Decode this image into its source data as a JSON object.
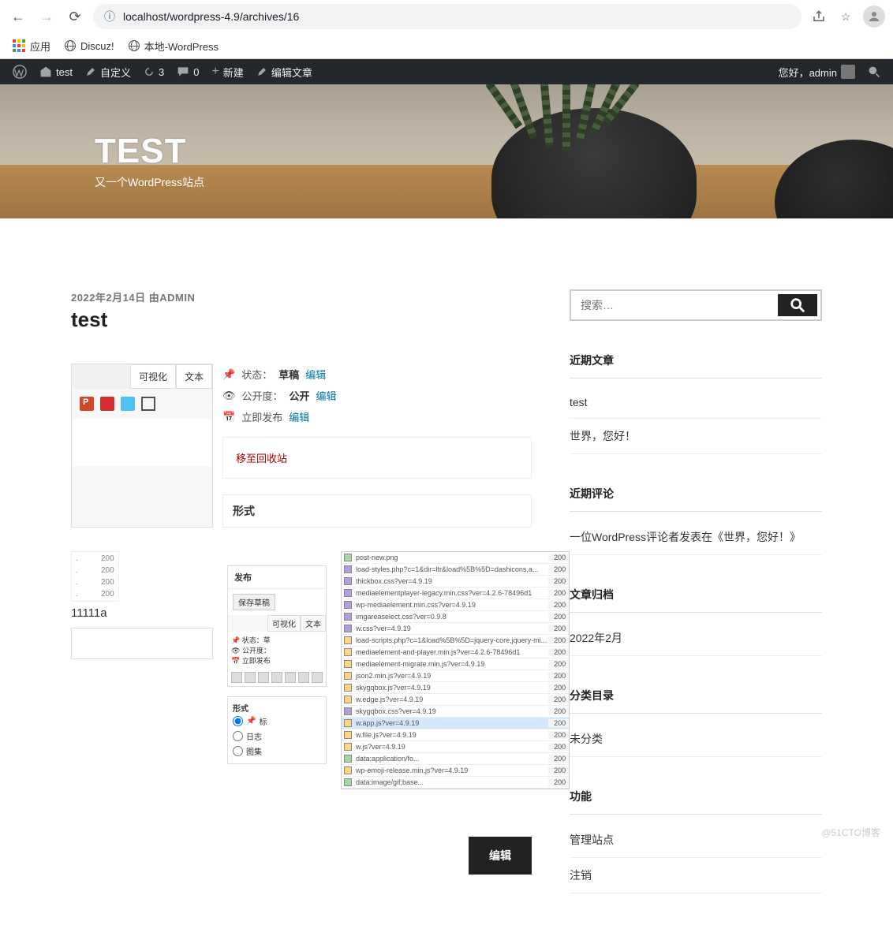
{
  "browser": {
    "url": "localhost/wordpress-4.9/archives/16",
    "bookmarks": {
      "apps": "应用",
      "discuz": "Discuz!",
      "local": "本地-WordPress"
    }
  },
  "adminbar": {
    "site": "test",
    "customize": "自定义",
    "updates": "3",
    "comments": "0",
    "new": "新建",
    "edit": "编辑文章",
    "greeting": "您好，admin"
  },
  "hero": {
    "title": "TEST",
    "tagline": "又一个WordPress站点"
  },
  "post": {
    "date": "2022年2月14日",
    "author_prefix": "由",
    "author": "ADMIN",
    "title": "test",
    "editor_tabs": {
      "visual": "可视化",
      "text": "文本"
    },
    "status_label": "状态：",
    "status_value": "草稿",
    "status_edit": "编辑",
    "visibility_label": "公开度：",
    "visibility_value": "公开",
    "visibility_edit": "编辑",
    "publish_label": "立即发布",
    "publish_edit": "编辑",
    "trash": "移至回收站",
    "format_title": "形式",
    "text111": "11111a",
    "tiny_rows": [
      "200",
      "200",
      "200",
      "200"
    ],
    "mini": {
      "publish": "发布",
      "save_draft": "保存草稿",
      "status": "状态：草",
      "vis": "公开度：",
      "sched": "立即发布",
      "format": "形式",
      "opt_standard": "标",
      "opt_log": "日志",
      "opt_gallery": "图集"
    },
    "network_rows": [
      {
        "n": "post-new.png",
        "s": "200",
        "t": "img"
      },
      {
        "n": "load-styles.php?c=1&dir=ltr&load%5B%5D=dashicons,a...",
        "s": "200",
        "t": "css"
      },
      {
        "n": "thickbox.css?ver=4.9.19",
        "s": "200",
        "t": "css"
      },
      {
        "n": "mediaelementplayer-legacy.min.css?ver=4.2.6-78496d1",
        "s": "200",
        "t": "css"
      },
      {
        "n": "wp-mediaelement.min.css?ver=4.9.19",
        "s": "200",
        "t": "css"
      },
      {
        "n": "imgareaselect.css?ver=0.9.8",
        "s": "200",
        "t": "css"
      },
      {
        "n": "w.css?ver=4.9.19",
        "s": "200",
        "t": "css"
      },
      {
        "n": "load-scripts.php?c=1&load%5B%5D=jquery-core,jquery-mi...",
        "s": "200",
        "t": "js"
      },
      {
        "n": "mediaelement-and-player.min.js?ver=4.2.6-78496d1",
        "s": "200",
        "t": "js"
      },
      {
        "n": "mediaelement-migrate.min.js?ver=4.9.19",
        "s": "200",
        "t": "js"
      },
      {
        "n": "json2.min.js?ver=4.9.19",
        "s": "200",
        "t": "js"
      },
      {
        "n": "skygqbox.js?ver=4.9.19",
        "s": "200",
        "t": "js"
      },
      {
        "n": "w.edge.js?ver=4.9.19",
        "s": "200",
        "t": "js"
      },
      {
        "n": "skygqbox.css?ver=4.9.19",
        "s": "200",
        "t": "css"
      },
      {
        "n": "w.app.js?ver=4.9.19",
        "s": "200",
        "t": "js",
        "hl": true
      },
      {
        "n": "w.file.js?ver=4.9.19",
        "s": "200",
        "t": "js"
      },
      {
        "n": "w.js?ver=4.9.19",
        "s": "200",
        "t": "js"
      },
      {
        "n": "data:application/fo...",
        "s": "200",
        "t": "img"
      },
      {
        "n": "wp-emoji-release.min.js?ver=4.9.19",
        "s": "200",
        "t": "js"
      },
      {
        "n": "data:image/gif;base...",
        "s": "200",
        "t": "img"
      }
    ],
    "edit_button": "编辑"
  },
  "sidebar": {
    "search_placeholder": "搜索…",
    "recent_posts": {
      "title": "近期文章",
      "items": [
        "test",
        "世界，您好！"
      ]
    },
    "recent_comments": {
      "title": "近期评论",
      "text": "一位WordPress评论者发表在《世界，您好！》"
    },
    "archives": {
      "title": "文章归档",
      "items": [
        "2022年2月"
      ]
    },
    "categories": {
      "title": "分类目录",
      "items": [
        "未分类"
      ]
    },
    "meta": {
      "title": "功能",
      "items": [
        "管理站点",
        "注销"
      ]
    }
  },
  "watermark": "@51CTO博客"
}
